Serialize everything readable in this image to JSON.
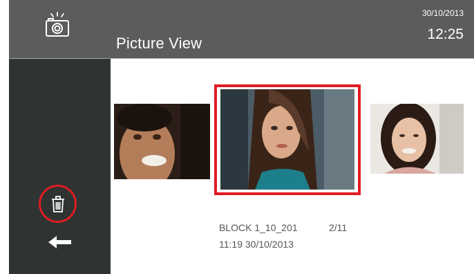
{
  "header": {
    "title": "Picture View",
    "date": "30/10/2013",
    "time": "12:25",
    "icon": "camera-icon"
  },
  "sidebar": {
    "delete_icon": "trash-icon",
    "back_icon": "back-arrow-icon"
  },
  "viewer": {
    "filename": "BLOCK 1_10_201",
    "counter": "2/11",
    "timestamp": "11:19 30/10/2013",
    "images": [
      {
        "name": "smiling-man-photo",
        "selected": false
      },
      {
        "name": "woman-portrait-photo",
        "selected": true
      },
      {
        "name": "smiling-woman-photo",
        "selected": false
      }
    ]
  },
  "colors": {
    "header_bg": "#5a5c5e",
    "sidebar_bg": "#2f3433",
    "selection": "#e11b22"
  }
}
